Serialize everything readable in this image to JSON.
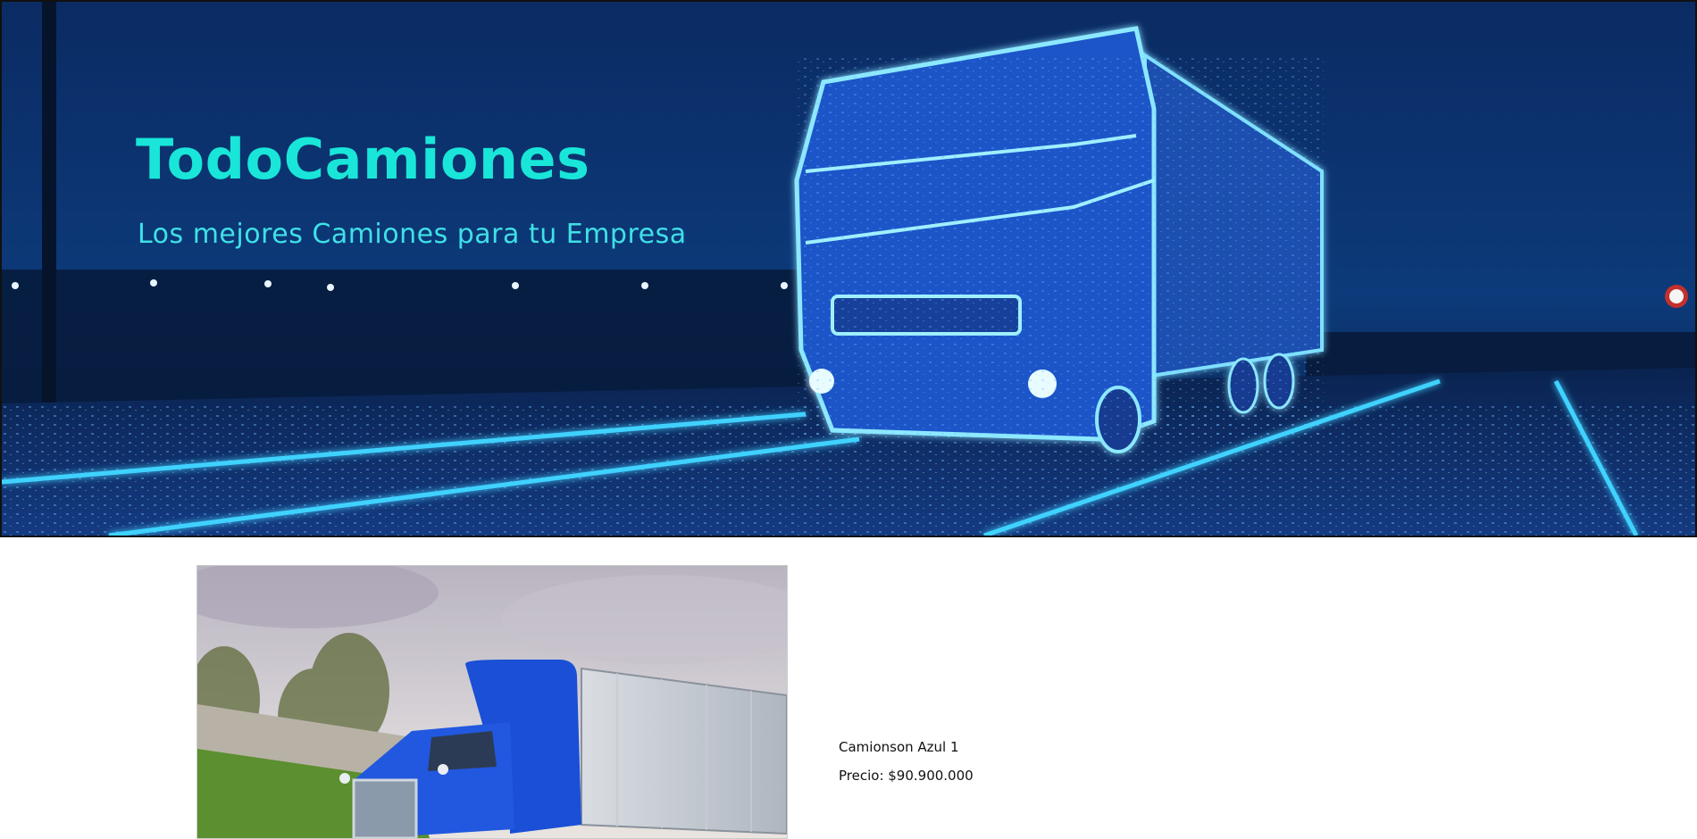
{
  "hero": {
    "title": "TodoCamiones",
    "subtitle": "Los mejores Camiones para tu Empresa"
  },
  "product": {
    "name": "Camionson Azul 1",
    "price": "Precio: $90.900.000"
  },
  "colors": {
    "title": "#19e6d8",
    "subtitle": "#3fe0e6",
    "hero_bg": "#0a2a5e",
    "truck_cab": "#1a4fd6"
  }
}
